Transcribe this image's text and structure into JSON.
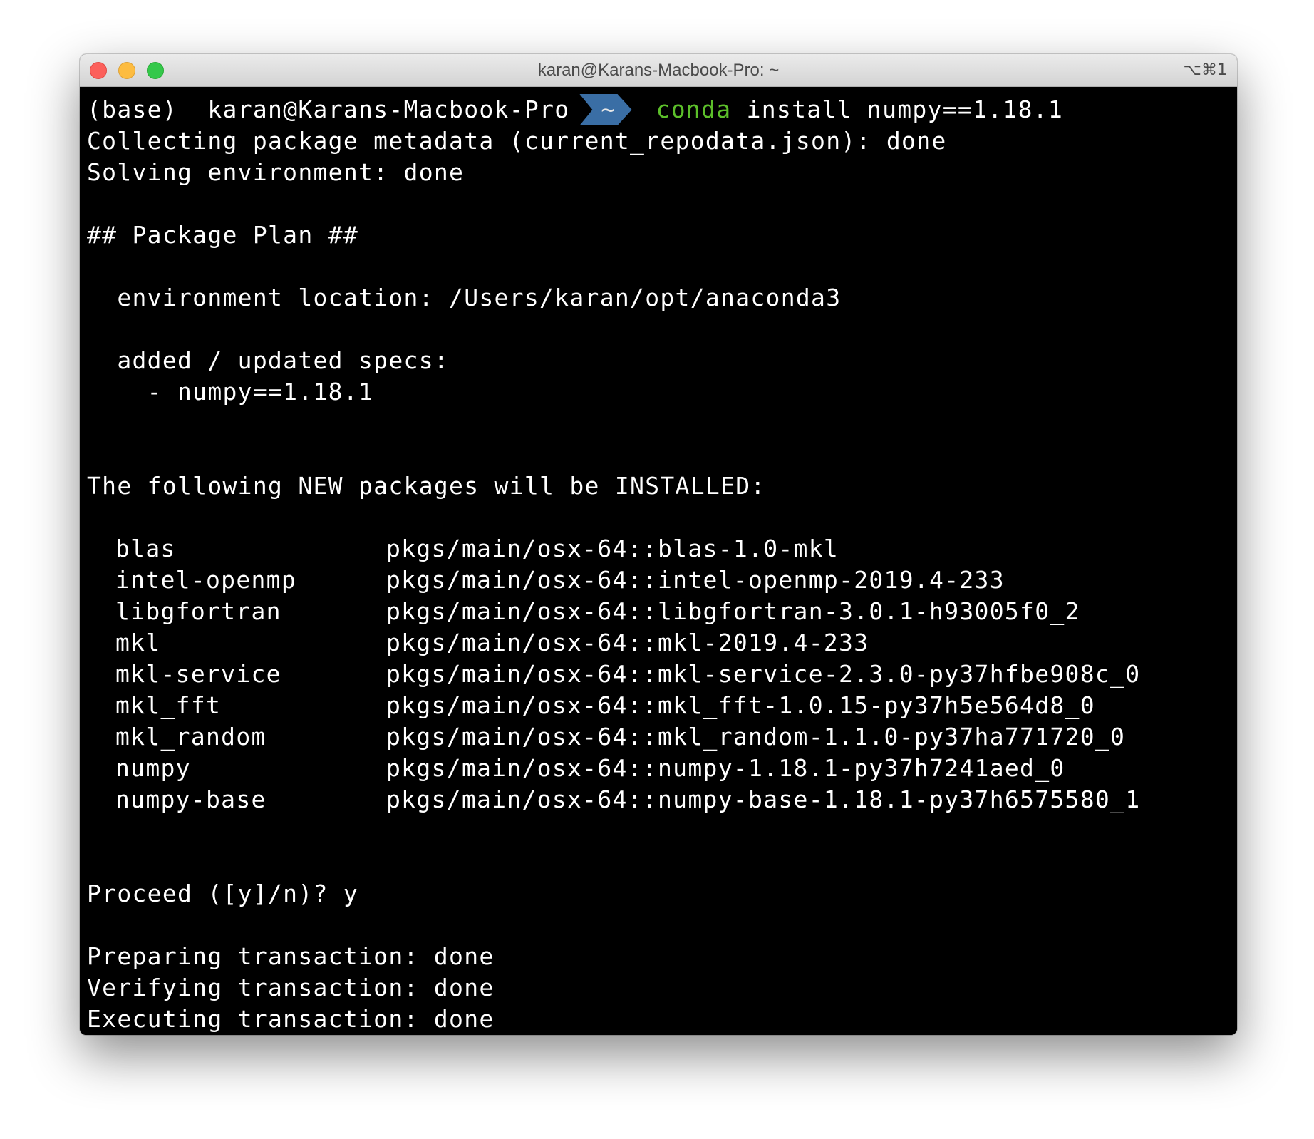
{
  "window": {
    "title": "karan@Karans-Macbook-Pro: ~",
    "shortcut": "⌥⌘1"
  },
  "prompt": {
    "env": "(base)",
    "user_host": "karan@Karans-Macbook-Pro",
    "dir": "~",
    "command": "conda",
    "args": "install numpy==1.18.1"
  },
  "output": {
    "collecting": "Collecting package metadata (current_repodata.json): done",
    "solving": "Solving environment: done",
    "plan_header": "## Package Plan ##",
    "env_location": "  environment location: /Users/karan/opt/anaconda3",
    "specs_header": "  added / updated specs:",
    "spec_item": "    - numpy==1.18.1",
    "new_packages_header": "The following NEW packages will be INSTALLED:",
    "packages": [
      {
        "name": "blas",
        "spec": "pkgs/main/osx-64::blas-1.0-mkl"
      },
      {
        "name": "intel-openmp",
        "spec": "pkgs/main/osx-64::intel-openmp-2019.4-233"
      },
      {
        "name": "libgfortran",
        "spec": "pkgs/main/osx-64::libgfortran-3.0.1-h93005f0_2"
      },
      {
        "name": "mkl",
        "spec": "pkgs/main/osx-64::mkl-2019.4-233"
      },
      {
        "name": "mkl-service",
        "spec": "pkgs/main/osx-64::mkl-service-2.3.0-py37hfbe908c_0"
      },
      {
        "name": "mkl_fft",
        "spec": "pkgs/main/osx-64::mkl_fft-1.0.15-py37h5e564d8_0"
      },
      {
        "name": "mkl_random",
        "spec": "pkgs/main/osx-64::mkl_random-1.1.0-py37ha771720_0"
      },
      {
        "name": "numpy",
        "spec": "pkgs/main/osx-64::numpy-1.18.1-py37h7241aed_0"
      },
      {
        "name": "numpy-base",
        "spec": "pkgs/main/osx-64::numpy-base-1.18.1-py37h6575580_1"
      }
    ],
    "proceed": "Proceed ([y]/n)? y",
    "preparing": "Preparing transaction: done",
    "verifying": "Verifying transaction: done",
    "executing": "Executing transaction: done"
  },
  "colors": {
    "prompt_dir_bg": "#3a6ea5",
    "command_green": "#5cbf2a",
    "terminal_bg": "#000000",
    "terminal_fg": "#ffffff"
  }
}
